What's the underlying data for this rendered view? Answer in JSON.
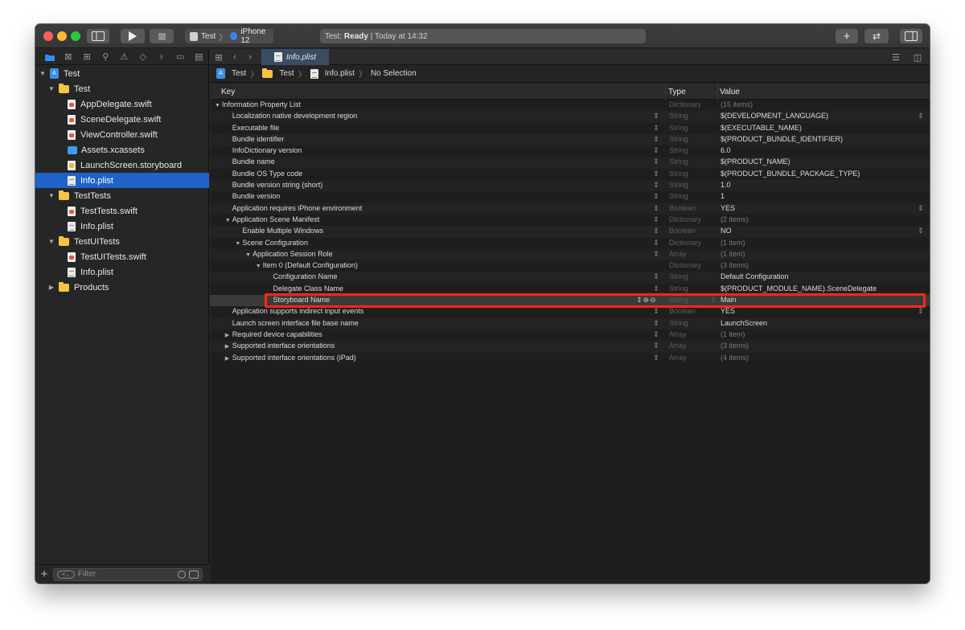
{
  "toolbar": {
    "scheme_project": "Test",
    "scheme_device": "iPhone 12",
    "status_project": "Test:",
    "status_state": "Ready",
    "status_time": "| Today at 14:32"
  },
  "navigator": {
    "items": [
      {
        "label": "Test",
        "icon": "project-icon",
        "indent": 0,
        "disclosure": "▼"
      },
      {
        "label": "Test",
        "icon": "folder-icon",
        "indent": 1,
        "disclosure": "▼"
      },
      {
        "label": "AppDelegate.swift",
        "icon": "swift-file-icon",
        "indent": 2,
        "disclosure": ""
      },
      {
        "label": "SceneDelegate.swift",
        "icon": "swift-file-icon",
        "indent": 2,
        "disclosure": ""
      },
      {
        "label": "ViewController.swift",
        "icon": "swift-file-icon",
        "indent": 2,
        "disclosure": ""
      },
      {
        "label": "Assets.xcassets",
        "icon": "assets-icon",
        "indent": 2,
        "disclosure": ""
      },
      {
        "label": "LaunchScreen.storyboard",
        "icon": "storyboard-icon",
        "indent": 2,
        "disclosure": ""
      },
      {
        "label": "Info.plist",
        "icon": "plist-icon",
        "indent": 2,
        "disclosure": "",
        "selected": true
      },
      {
        "label": "TestTests",
        "icon": "folder-icon",
        "indent": 1,
        "disclosure": "▼"
      },
      {
        "label": "TestTests.swift",
        "icon": "swift-file-icon",
        "indent": 2,
        "disclosure": ""
      },
      {
        "label": "Info.plist",
        "icon": "plist-icon",
        "indent": 2,
        "disclosure": ""
      },
      {
        "label": "TestUITests",
        "icon": "folder-icon",
        "indent": 1,
        "disclosure": "▼"
      },
      {
        "label": "TestUITests.swift",
        "icon": "swift-file-icon",
        "indent": 2,
        "disclosure": ""
      },
      {
        "label": "Info.plist",
        "icon": "plist-icon",
        "indent": 2,
        "disclosure": ""
      },
      {
        "label": "Products",
        "icon": "folder-icon",
        "indent": 1,
        "disclosure": "▶"
      }
    ],
    "filter_placeholder": "Filter"
  },
  "editor": {
    "tab_title": "Info.plist",
    "breadcrumb": [
      "Test",
      "Test",
      "Info.plist",
      "No Selection"
    ]
  },
  "plist": {
    "headers": {
      "key": "Key",
      "type": "Type",
      "value": "Value"
    },
    "rows": [
      {
        "key": "Information Property List",
        "indent": 0,
        "arrow": "▼",
        "type": "Dictionary",
        "value": "(15 items)",
        "dim": true
      },
      {
        "key": "Localization native development region",
        "indent": 1,
        "arrow": "",
        "type": "String",
        "value": "$(DEVELOPMENT_LANGUAGE)",
        "stepper": true,
        "vstep": true
      },
      {
        "key": "Executable file",
        "indent": 1,
        "arrow": "",
        "type": "String",
        "value": "$(EXECUTABLE_NAME)",
        "stepper": true
      },
      {
        "key": "Bundle identifier",
        "indent": 1,
        "arrow": "",
        "type": "String",
        "value": "$(PRODUCT_BUNDLE_IDENTIFIER)",
        "stepper": true
      },
      {
        "key": "InfoDictionary version",
        "indent": 1,
        "arrow": "",
        "type": "String",
        "value": "6.0",
        "stepper": true
      },
      {
        "key": "Bundle name",
        "indent": 1,
        "arrow": "",
        "type": "String",
        "value": "$(PRODUCT_NAME)",
        "stepper": true
      },
      {
        "key": "Bundle OS Type code",
        "indent": 1,
        "arrow": "",
        "type": "String",
        "value": "$(PRODUCT_BUNDLE_PACKAGE_TYPE)",
        "stepper": true
      },
      {
        "key": "Bundle version string (short)",
        "indent": 1,
        "arrow": "",
        "type": "String",
        "value": "1.0",
        "stepper": true
      },
      {
        "key": "Bundle version",
        "indent": 1,
        "arrow": "",
        "type": "String",
        "value": "1",
        "stepper": true
      },
      {
        "key": "Application requires iPhone environment",
        "indent": 1,
        "arrow": "",
        "type": "Boolean",
        "value": "YES",
        "stepper": true,
        "vstep": true
      },
      {
        "key": "Application Scene Manifest",
        "indent": 1,
        "arrow": "▼",
        "type": "Dictionary",
        "value": "(2 items)",
        "dim": true,
        "stepper": true
      },
      {
        "key": "Enable Multiple Windows",
        "indent": 2,
        "arrow": "",
        "type": "Boolean",
        "value": "NO",
        "stepper": true,
        "vstep": true
      },
      {
        "key": "Scene Configuration",
        "indent": 2,
        "arrow": "▼",
        "type": "Dictionary",
        "value": "(1 item)",
        "dim": true,
        "stepper": true
      },
      {
        "key": "Application Session Role",
        "indent": 3,
        "arrow": "▼",
        "type": "Array",
        "value": "(1 item)",
        "dim": true,
        "stepper": true
      },
      {
        "key": "Item 0 (Default Configuration)",
        "indent": 4,
        "arrow": "▼",
        "type": "Dictionary",
        "value": "(3 items)",
        "dim": true
      },
      {
        "key": "Configuration Name",
        "indent": 5,
        "arrow": "",
        "type": "String",
        "value": "Default Configuration",
        "stepper": true
      },
      {
        "key": "Delegate Class Name",
        "indent": 5,
        "arrow": "",
        "type": "String",
        "value": "$(PRODUCT_MODULE_NAME).SceneDelegate",
        "stepper": true
      },
      {
        "key": "Storyboard Name",
        "indent": 5,
        "arrow": "",
        "type": "String",
        "value": "Main",
        "highlight": true
      },
      {
        "key": "Application supports indirect input events",
        "indent": 1,
        "arrow": "",
        "type": "Boolean",
        "value": "YES",
        "stepper": true,
        "vstep": true
      },
      {
        "key": "Launch screen interface file base name",
        "indent": 1,
        "arrow": "",
        "type": "String",
        "value": "LaunchScreen",
        "stepper": true
      },
      {
        "key": "Required device capabilities",
        "indent": 1,
        "arrow": "▶",
        "type": "Array",
        "value": "(1 item)",
        "dim": true,
        "stepper": true
      },
      {
        "key": "Supported interface orientations",
        "indent": 1,
        "arrow": "▶",
        "type": "Array",
        "value": "(3 items)",
        "dim": true,
        "stepper": true
      },
      {
        "key": "Supported interface orientations (iPad)",
        "indent": 1,
        "arrow": "▶",
        "type": "Array",
        "value": "(4 items)",
        "dim": true,
        "stepper": true
      }
    ]
  },
  "colors": {
    "highlight_outline": "#ff2618",
    "selection": "#1f62c8",
    "accent": "#2f8cf6"
  }
}
